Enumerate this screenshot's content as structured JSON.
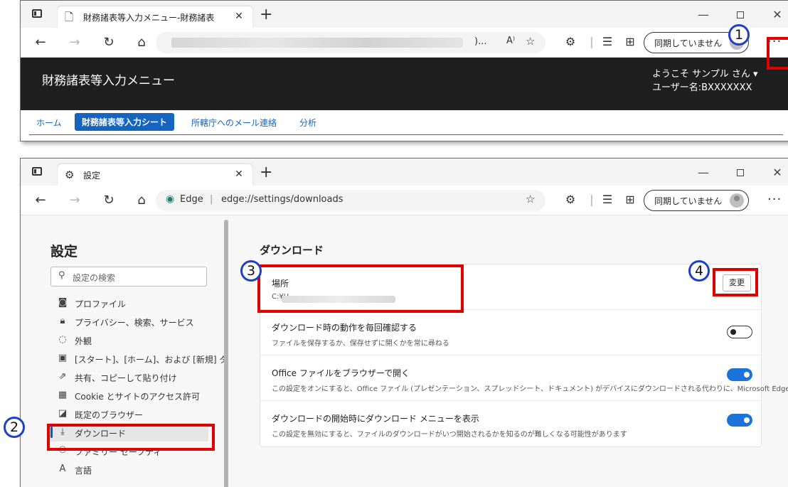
{
  "window1": {
    "tab_title": "財務諸表等入力メニュー-財務諸表",
    "url_tail": ")...",
    "sync_label": "同期していません",
    "app_title": "財務諸表等入力メニュー",
    "welcome": "ようこそ サンプル さん ▾",
    "username": "ユーザー名:BXXXXXXX",
    "nav": [
      "ホーム",
      "財務諸表等入力シート",
      "所轄庁へのメール連絡",
      "分析"
    ]
  },
  "window2": {
    "tab_title": "設定",
    "url_brand": "Edge",
    "url_path": "edge://settings/downloads",
    "sync_label": "同期していません",
    "sidebar": {
      "title": "設定",
      "search_placeholder": "設定の検索",
      "items": [
        {
          "label": "プロファイル",
          "icon": "profile-icon"
        },
        {
          "label": "プライバシー、検索、サービス",
          "icon": "lock-icon"
        },
        {
          "label": "外観",
          "icon": "appearance-icon"
        },
        {
          "label": "[スタート]、[ホーム]、および [新規] タブ",
          "icon": "start-page-icon"
        },
        {
          "label": "共有、コピーして貼り付け",
          "icon": "share-icon"
        },
        {
          "label": "Cookie とサイトのアクセス許可",
          "icon": "cookie-icon"
        },
        {
          "label": "既定のブラウザー",
          "icon": "default-browser-icon"
        },
        {
          "label": "ダウンロード",
          "icon": "download-icon"
        },
        {
          "label": "ファミリー セーフティ",
          "icon": "family-icon"
        },
        {
          "label": "言語",
          "icon": "language-icon"
        }
      ]
    },
    "main": {
      "title": "ダウンロード",
      "location_label": "場所",
      "location_value": "C:¥U",
      "change_button": "変更",
      "ask_label": "ダウンロード時の動作を毎回確認する",
      "ask_desc": "ファイルを保存するか、保存せずに開くかを常に尋ねる",
      "office_label": "Office ファイルをブラウザーで開く",
      "office_desc": "この設定をオンにすると、Office ファイル (プレゼンテーション、スプレッドシート、ドキュメント) がデバイスにダウンロードされる代わりに、Microsoft Edge で自動的に開きます",
      "menu_label": "ダウンロードの開始時にダウンロード メニューを表示",
      "menu_desc": "この設定を無効にすると、ファイルのダウンロードがいつ開始されるかを知るのが難しくなる可能性があります"
    }
  },
  "annotations": {
    "n1": "1",
    "n2": "2",
    "n3": "3",
    "n4": "4"
  },
  "colors": {
    "highlight": "#e00000",
    "marker": "#1f3fc8",
    "accent": "#1a73d9"
  }
}
